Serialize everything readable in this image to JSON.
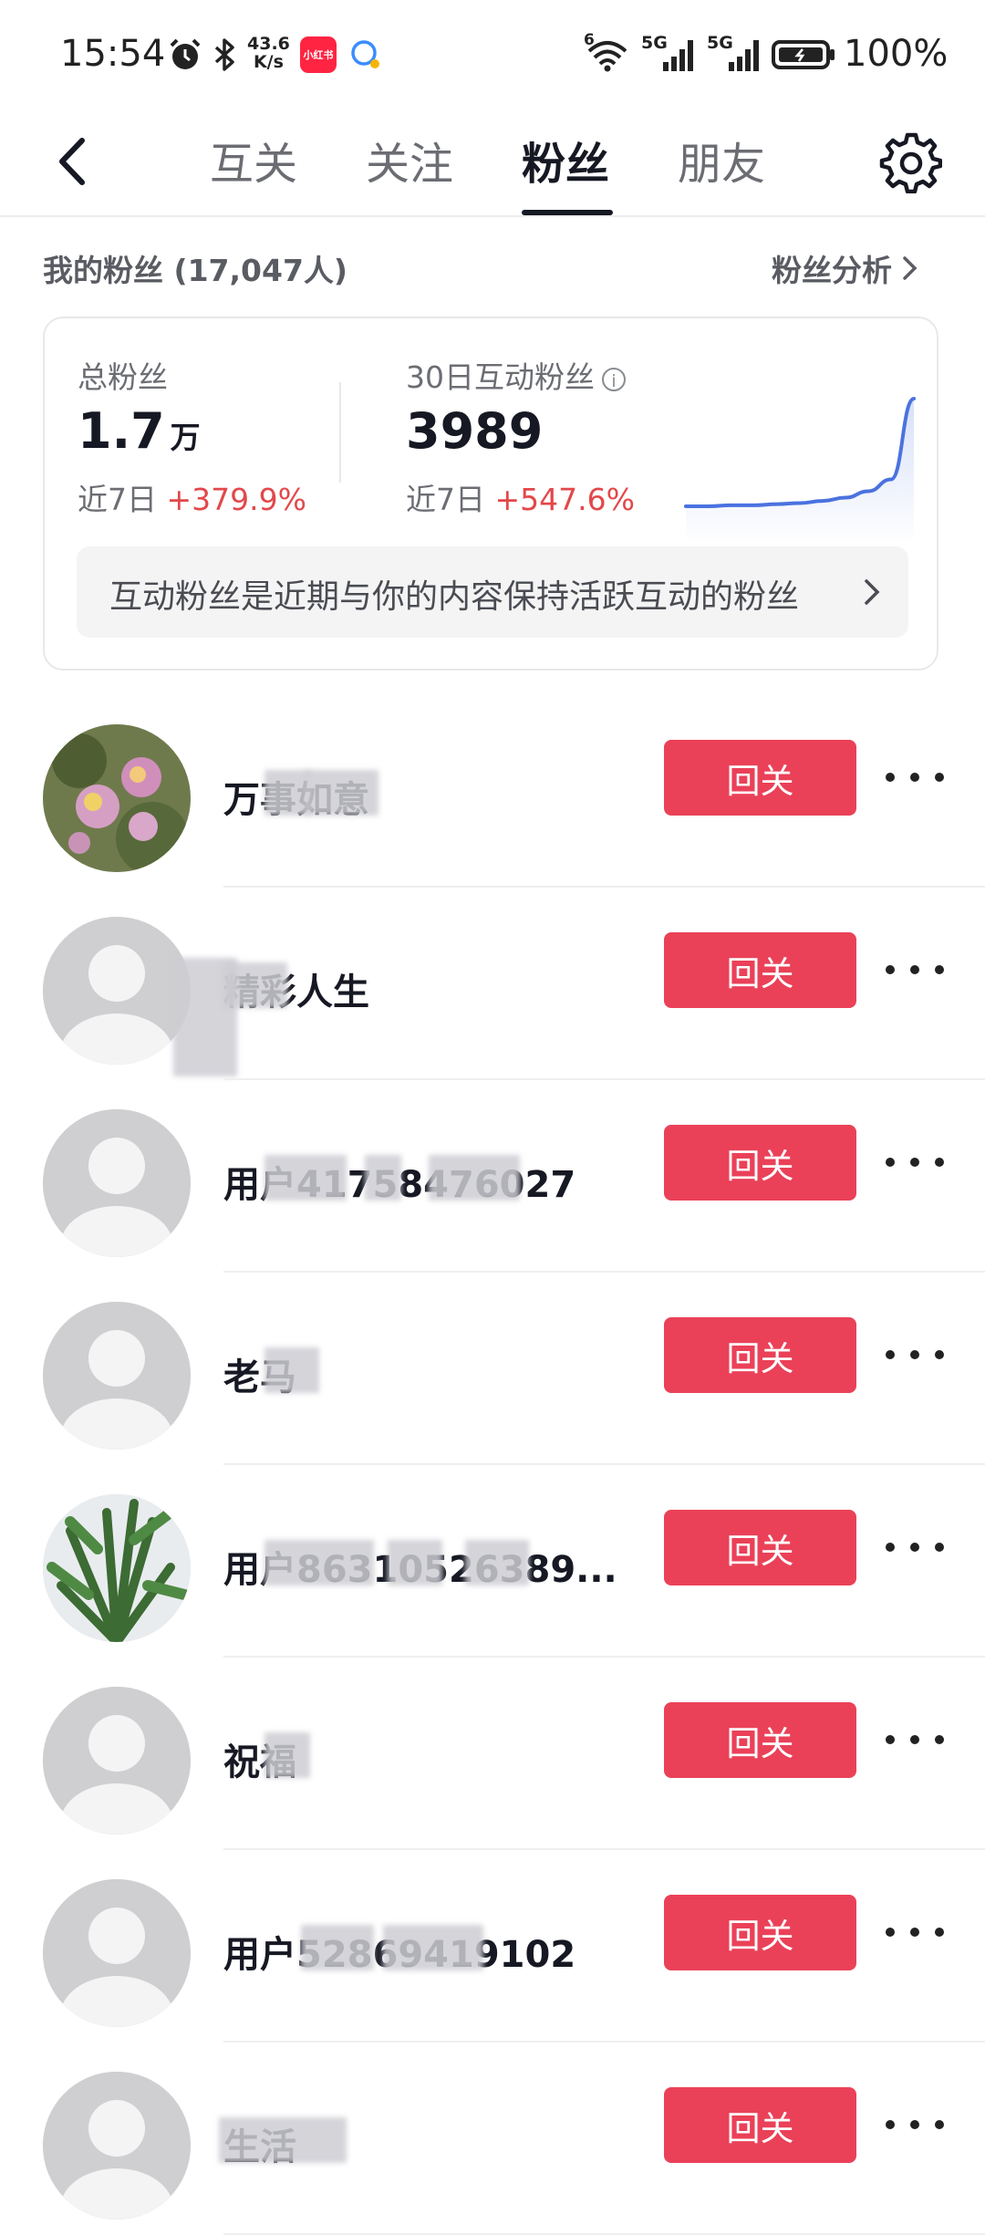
{
  "status_bar": {
    "time": "15:54",
    "net_speed_value": "43.6",
    "net_speed_unit": "K/s",
    "app_badge": "小红书",
    "signal_1_label": "5G",
    "signal_2_label": "5G",
    "wifi_label": "6",
    "battery_percent": "100%",
    "icons": [
      "alarm-icon",
      "bluetooth-icon",
      "xiaohongshu-app-icon",
      "chat-bubble-icon",
      "wifi-icon",
      "signal-icon",
      "battery-icon"
    ]
  },
  "nav": {
    "tabs": [
      {
        "label": "互关",
        "active": false
      },
      {
        "label": "关注",
        "active": false
      },
      {
        "label": "粉丝",
        "active": true
      },
      {
        "label": "朋友",
        "active": false
      }
    ]
  },
  "fans_header": {
    "title": "我的粉丝 (17,047人)",
    "analysis_link": "粉丝分析"
  },
  "stats": {
    "total": {
      "label": "总粉丝",
      "value": "1.7",
      "unit": "万",
      "change_prefix": "近7日",
      "change_value": "+379.9%"
    },
    "interactive": {
      "label": "30日互动粉丝",
      "value": "3989",
      "change_prefix": "近7日",
      "change_value": "+547.6%"
    },
    "trend_curve": [
      0,
      0,
      0.01,
      0.01,
      0.02,
      0.03,
      0.05,
      0.08,
      0.14,
      0.25,
      1.0
    ],
    "notice": "互动粉丝是近期与你的内容保持活跃互动的粉丝"
  },
  "fans": [
    {
      "name": "万事如意",
      "avatar": "flower",
      "button": "回关"
    },
    {
      "name": "精彩人生",
      "avatar": "default",
      "button": "回关"
    },
    {
      "name": "用户41758476027",
      "avatar": "default",
      "button": "回关"
    },
    {
      "name": "老马",
      "avatar": "default",
      "button": "回关"
    },
    {
      "name": "用户86310526389...",
      "avatar": "plant",
      "button": "回关"
    },
    {
      "name": "祝福",
      "avatar": "default",
      "button": "回关"
    },
    {
      "name": "用户52869419102",
      "avatar": "default",
      "button": "回关"
    },
    {
      "name": "生活",
      "avatar": "default",
      "button": "回关"
    }
  ],
  "colors": {
    "accent": "#ea4158",
    "positive_change": "#e2484a",
    "trend_line": "#4a72e0"
  }
}
